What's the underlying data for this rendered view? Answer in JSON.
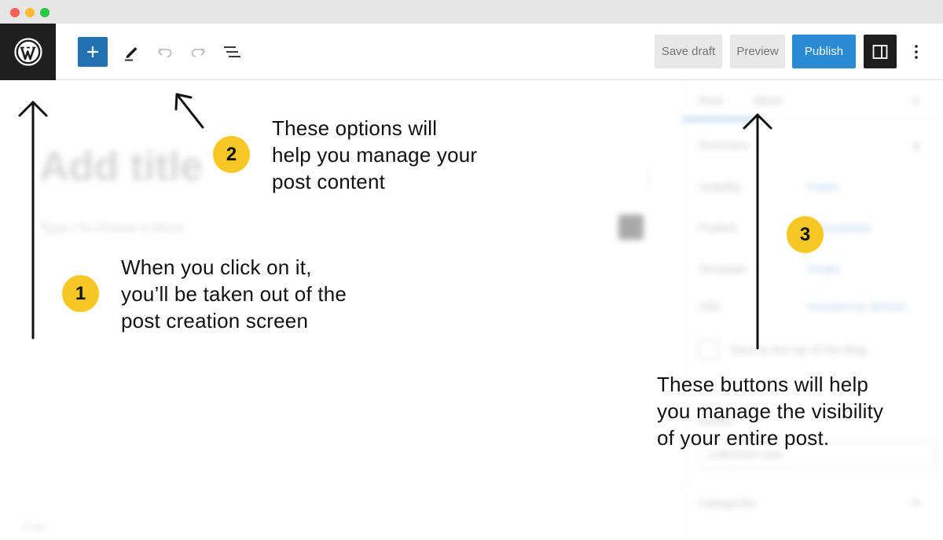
{
  "window": {
    "controls": [
      "close",
      "minimize",
      "zoom"
    ]
  },
  "toolbar": {
    "logo": "wordpress-icon",
    "add_block": "plus-icon",
    "tools": "pencil-icon",
    "undo": "undo-icon",
    "redo": "redo-icon",
    "list_view": "list-view-icon",
    "save_draft_label": "Save draft",
    "preview_label": "Preview",
    "publish_label": "Publish",
    "settings": "sidebar-toggle-icon",
    "options": "more-vertical-icon"
  },
  "editor": {
    "title_placeholder": "Add title",
    "paragraph_placeholder": "Type / to choose a block",
    "footer_label": "Post"
  },
  "sidebar": {
    "tabs": [
      "Post",
      "Block"
    ],
    "summary_title": "Summary",
    "rows": [
      {
        "label": "Visibility",
        "value": "Public"
      },
      {
        "label": "Publish",
        "value": "Immediately"
      },
      {
        "label": "Template",
        "value": "Single"
      },
      {
        "label": "URL",
        "value": "/created-by-default"
      }
    ],
    "sticky_label": "Stick to the top of the blog",
    "author_section": "Author",
    "author_value": "Unknown user",
    "categories_section": "Categories"
  },
  "annotations": [
    {
      "number": "1",
      "text_lines": [
        "When you click on it,",
        "you’ll be taken out of the",
        "post creation screen"
      ]
    },
    {
      "number": "2",
      "text_lines": [
        "These options will",
        "help you manage your",
        "post content"
      ]
    },
    {
      "number": "3",
      "text_lines": [
        "These buttons will help",
        "you manage the visibility",
        "of your entire post."
      ]
    }
  ],
  "colors": {
    "accent_blue": "#2271b1",
    "publish_blue": "#2a8ad4",
    "badge_yellow": "#f7c726",
    "dark": "#1e1e1e"
  }
}
